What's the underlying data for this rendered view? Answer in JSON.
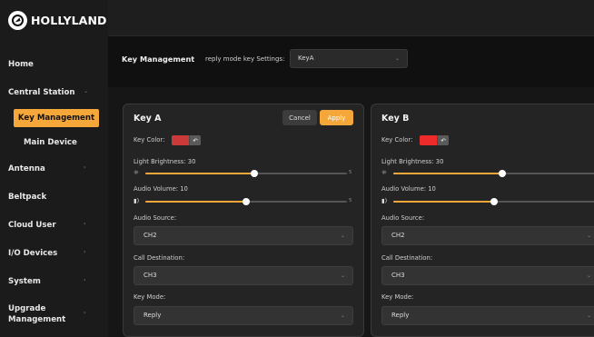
{
  "brand": {
    "name": "HOLLYLAND"
  },
  "sidebar": {
    "items": [
      {
        "label": "Home",
        "chevron": ""
      },
      {
        "label": "Central Station",
        "chevron": "⌄"
      },
      {
        "label": "Key Management",
        "chevron": ""
      },
      {
        "label": "Main Device",
        "chevron": ""
      },
      {
        "label": "Antenna",
        "chevron": "›"
      },
      {
        "label": "Beltpack",
        "chevron": ""
      },
      {
        "label": "Cloud User",
        "chevron": "›"
      },
      {
        "label": "I/O Devices",
        "chevron": "›"
      },
      {
        "label": "System",
        "chevron": "›"
      },
      {
        "label": "Upgrade",
        "label2": "Management",
        "chevron": "›"
      }
    ]
  },
  "settings": {
    "title": "Key Management",
    "reply_label": "reply mode key Settings:",
    "reply_value": "KeyA"
  },
  "cards": [
    {
      "title": "Key A",
      "cancel_label": "Cancel",
      "apply_label": "Apply",
      "key_color_label": "Key Color:",
      "key_color": "#c93a3a",
      "key_color_slashed": true,
      "brightness_label": "Light Brightness: 30",
      "brightness_fraction": 0.54,
      "brightness_max": "5",
      "volume_label": "Audio Volume: 10",
      "volume_fraction": 0.5,
      "volume_max": "5",
      "source_label": "Audio Source:",
      "source_value": "CH2",
      "destination_label": "Call Destination:",
      "destination_value": "CH3",
      "mode_label": "Key Mode:",
      "mode_value": "Reply"
    },
    {
      "title": "Key B",
      "key_color_label": "Key Color:",
      "key_color": "#ee2b2b",
      "key_color_slashed": false,
      "brightness_label": "Light Brightness: 30",
      "brightness_fraction": 0.54,
      "volume_label": "Audio Volume: 10",
      "volume_fraction": 0.5,
      "source_label": "Audio Source:",
      "source_value": "CH2",
      "destination_label": "Call Destination:",
      "destination_value": "CH3",
      "mode_label": "Key Mode:",
      "mode_value": "Reply"
    }
  ],
  "icons": {
    "brightness": "sun-icon",
    "volume": "speaker-icon",
    "picker": "picker-icon",
    "dropdown": "chevron-down-icon"
  },
  "colors": {
    "accent": "#f5a73a"
  }
}
